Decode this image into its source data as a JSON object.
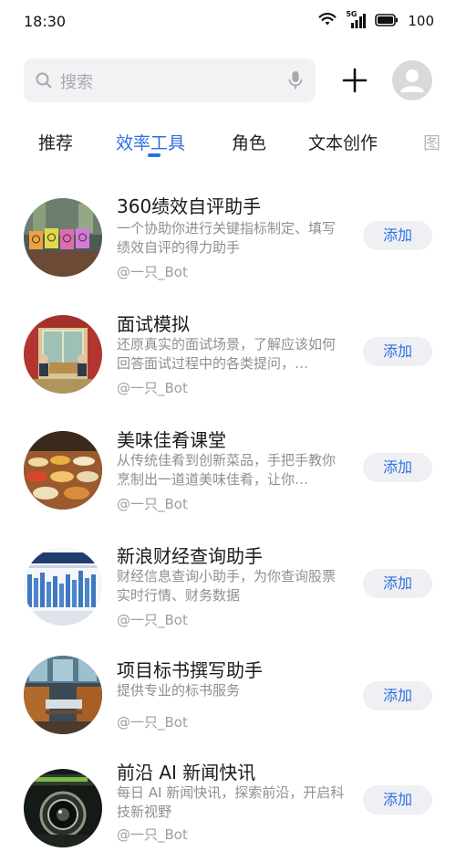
{
  "status_bar": {
    "time": "18:30",
    "signal_label": "5G",
    "battery": "100",
    "icons": [
      "wifi-icon",
      "cellular-signal-icon",
      "battery-icon"
    ]
  },
  "search": {
    "placeholder": "搜索",
    "icons": [
      "search-icon",
      "microphone-icon",
      "plus-icon",
      "user-avatar-icon"
    ]
  },
  "tabs": [
    {
      "label": "推荐",
      "active": false
    },
    {
      "label": "效率工具",
      "active": true
    },
    {
      "label": "角色",
      "active": false
    },
    {
      "label": "文本创作",
      "active": false
    },
    {
      "label": "图",
      "active": false
    }
  ],
  "colors": {
    "accent": "#2f6fe4",
    "secondary_text": "#8c8f94",
    "search_bg": "#f1f2f4",
    "button_bg": "#eef0f3"
  },
  "bots": [
    {
      "title": "360绩效自评助手",
      "description": "一个协助你进行关键指标制定、填写绩效自评的得力助手",
      "author": "@一只_Bot",
      "action": "添加"
    },
    {
      "title": "面试模拟",
      "description": "还原真实的面试场景，了解应该如何回答面试过程中的各类提问，…",
      "author": "@一只_Bot",
      "action": "添加"
    },
    {
      "title": "美味佳肴课堂",
      "description": "从传统佳肴到创新菜品，手把手教你烹制出一道道美味佳肴，让你…",
      "author": "@一只_Bot",
      "action": "添加"
    },
    {
      "title": "新浪财经查询助手",
      "description": "财经信息查询小助手，为你查询股票实时行情、财务数据",
      "author": "@一只_Bot",
      "action": "添加"
    },
    {
      "title": "项目标书撰写助手",
      "description": "提供专业的标书服务",
      "author": "@一只_Bot",
      "action": "添加"
    },
    {
      "title": "前沿 AI 新闻快讯",
      "description": "每日 AI 新闻快讯，探索前沿，开启科技新视野",
      "author": "@一只_Bot",
      "action": "添加"
    }
  ]
}
